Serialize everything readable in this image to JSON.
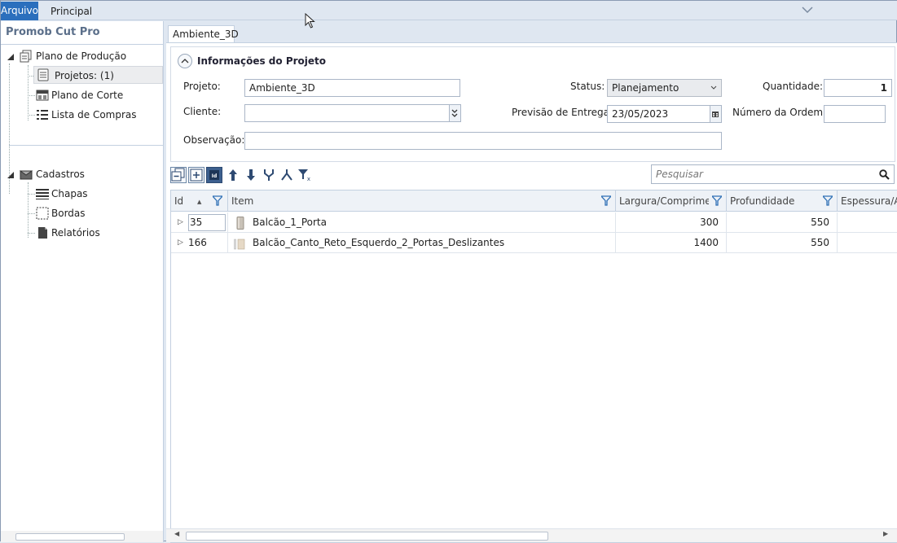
{
  "ribbon": {
    "file_tab": "Arquivo",
    "main_tab": "Principal"
  },
  "sidebar": {
    "app_title": "Promob Cut Pro",
    "sections": [
      {
        "label": "Plano de Produção",
        "icon": "production-plan-icon",
        "items": [
          {
            "label": "Projetos: (1)",
            "icon": "document-icon",
            "selected": true
          },
          {
            "label": "Plano de Corte",
            "icon": "cut-plan-icon",
            "selected": false
          },
          {
            "label": "Lista de Compras",
            "icon": "list-icon",
            "selected": false
          }
        ]
      },
      {
        "label": "Cadastros",
        "icon": "registry-box-icon",
        "items": [
          {
            "label": "Chapas",
            "icon": "sheets-icon"
          },
          {
            "label": "Bordas",
            "icon": "edges-icon"
          },
          {
            "label": "Relatórios",
            "icon": "report-icon"
          }
        ]
      }
    ]
  },
  "document_tab": "Ambiente_3D",
  "project_info": {
    "header": "Informações do Projeto",
    "fields": {
      "projeto_label": "Projeto:",
      "projeto_value": "Ambiente_3D",
      "cliente_label": "Cliente:",
      "cliente_value": "",
      "observacao_label": "Observação:",
      "observacao_value": "",
      "status_label": "Status:",
      "status_value": "Planejamento",
      "previsao_label": "Previsão de Entrega:",
      "previsao_value": "23/05/2023",
      "quantidade_label": "Quantidade:",
      "quantidade_value": "1",
      "numero_ordem_label": "Número da Ordem:",
      "numero_ordem_value": ""
    }
  },
  "toolbar": {
    "buttons": [
      "collapse-all-icon",
      "expand-all-icon",
      "id-toggle-icon",
      "move-up-icon",
      "move-down-icon",
      "merge-icon",
      "split-icon",
      "clear-filter-icon"
    ]
  },
  "search": {
    "placeholder": "Pesquisar"
  },
  "grid": {
    "columns": [
      "Id",
      "Item",
      "Largura/Comprimento",
      "Profundidade",
      "Espessura/Altura"
    ],
    "rows": [
      {
        "id": "35",
        "item": "Balcão_1_Porta",
        "largura": "300",
        "profundidade": "550",
        "espessura": ""
      },
      {
        "id": "166",
        "item": "Balcão_Canto_Reto_Esquerdo_2_Portas_Deslizantes",
        "largura": "1400",
        "profundidade": "550",
        "espessura": ""
      }
    ]
  },
  "colors": {
    "accent": "#2b6fbd",
    "ribbon_bg": "#dfe7f1",
    "selected_bg": "#ecedef"
  }
}
